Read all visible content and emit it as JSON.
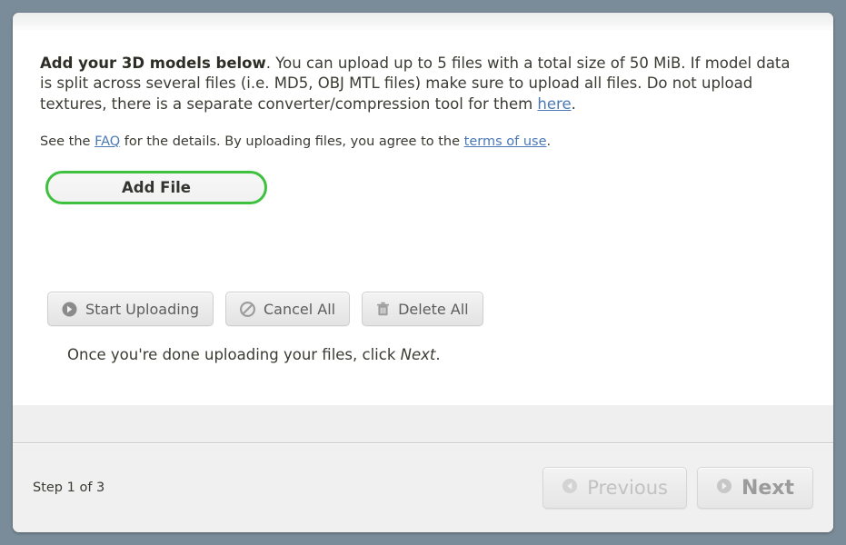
{
  "intro": {
    "bold_lead": "Add your 3D models below",
    "text_1": ". You can upload up to 5 files with a total size of 50 MiB. If model data is split across several files (i.e. MD5, OBJ MTL files) make sure to upload all files. Do not upload textures, there is a separate converter/compression tool for them ",
    "link_here": "here",
    "text_2": "."
  },
  "subline": {
    "text_1": "See the ",
    "link_faq": "FAQ",
    "text_2": " for the details. By uploading files, you agree to the ",
    "link_terms": "terms of use",
    "text_3": "."
  },
  "add_file": {
    "label": "Add File",
    "border_color": "#3fc13f"
  },
  "actions": [
    {
      "label": "Start Uploading",
      "icon": "circle-arrow-right-icon",
      "name": "start-uploading-button"
    },
    {
      "label": "Cancel All",
      "icon": "ban-icon",
      "name": "cancel-all-button"
    },
    {
      "label": "Delete All",
      "icon": "trash-icon",
      "name": "delete-all-button"
    }
  ],
  "hint": {
    "text_1": "Once you're done uploading your files, click ",
    "emphasis": "Next",
    "text_2": "."
  },
  "footer": {
    "step": "Step 1 of 3",
    "previous": {
      "label": "Previous",
      "icon": "circle-arrow-left-icon"
    },
    "next": {
      "label": "Next",
      "icon": "circle-arrow-right-icon"
    }
  },
  "colors": {
    "page_background": "#7a8c99",
    "link": "#4a79b5",
    "accent_green": "#3fc13f"
  }
}
